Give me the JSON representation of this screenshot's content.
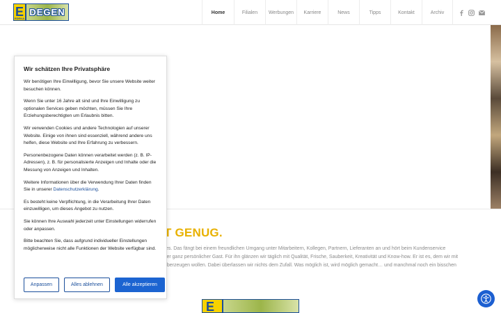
{
  "header": {
    "logo_letter": "E",
    "logo_small": "EDEKA",
    "logo_word": "DEGEN",
    "nav": [
      {
        "label": "Home",
        "active": true
      },
      {
        "label": "Filialen",
        "active": false
      },
      {
        "label": "Werbungen",
        "active": false
      },
      {
        "label": "Karriere",
        "active": false
      },
      {
        "label": "News",
        "active": false
      },
      {
        "label": "Tipps",
        "active": false
      },
      {
        "label": "Kontakt",
        "active": false
      },
      {
        "label": "Archiv",
        "active": false
      }
    ],
    "social": [
      "facebook-icon",
      "instagram-icon",
      "mail-icon"
    ]
  },
  "content": {
    "headline": "T GENUG.",
    "lines": [
      "tes. Das fängt bei einem freundlichen Umgang unter Mitarbeitern, Kollegen, Partnern, Lieferanten an und hört beim Kundenservice",
      "ser ganz persönlicher Gast. Für ihn glänzen wir täglich mit Qualität, Frische, Sauberkeit, Kreativität und Know-how. Er ist es, dem wir mit",
      "überzeugen wollen. Dabei überlassen wir nichts dem Zufall. Was möglich ist, wird möglich gemacht… und manchmal noch ein bisschen"
    ]
  },
  "consent": {
    "title": "Wir schätzen Ihre Privatsphäre",
    "p1": "Wir benötigen Ihre Einwilligung, bevor Sie unsere Website weiter besuchen können.",
    "p2": "Wenn Sie unter 16 Jahre alt sind und Ihre Einwilligung zu optionalen Services geben möchten, müssen Sie Ihre Erziehungsberechtigten um Erlaubnis bitten.",
    "p3": "Wir verwenden Cookies und andere Technologien auf unserer Website. Einige von ihnen sind essenziell, während andere uns helfen, diese Website und Ihre Erfahrung zu verbessern.",
    "p4": "Personenbezogene Daten können verarbeitet werden (z. B. IP-Adressen), z. B. für personalisierte Anzeigen und Inhalte oder die Messung von Anzeigen und Inhalten.",
    "p5_before": "Weitere Informationen über die Verwendung Ihrer Daten finden Sie in unserer ",
    "p5_link": "Datenschutzerklärung",
    "p5_after": ".",
    "p6": "Es besteht keine Verpflichtung, in die Verarbeitung Ihrer Daten einzuwilligen, um dieses Angebot zu nutzen.",
    "p7": "Sie können Ihre Auswahl jederzeit unter Einstellungen widerrufen oder anpassen.",
    "p8": "Bitte beachten Sie, dass aufgrund individueller Einstellungen möglicherweise nicht alle Funktionen der Website verfügbar sind.",
    "btn_customize": "Anpassen",
    "btn_reject": "Alles ablehnen",
    "btn_accept": "Alle akzeptieren"
  },
  "colors": {
    "accent_yellow": "#e8b100",
    "brand_blue": "#1a4e9b",
    "button_blue": "#1c64d1"
  },
  "accessibility_icon": "accessibility-icon"
}
